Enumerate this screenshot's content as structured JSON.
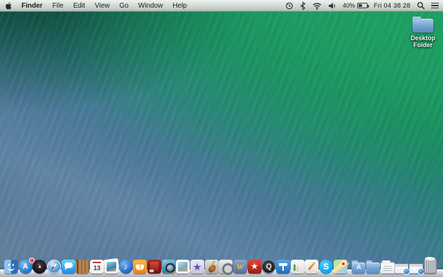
{
  "menu_bar": {
    "app_name": "Finder",
    "menus": [
      "File",
      "Edit",
      "View",
      "Go",
      "Window",
      "Help"
    ],
    "status": {
      "icons": [
        "time-machine",
        "bluetooth",
        "wifi",
        "volume"
      ],
      "battery_percent": "40%",
      "clock": "Fri 04 38 28"
    }
  },
  "desktop": {
    "folder_label": "Desktop Folder"
  },
  "dock": {
    "items": [
      {
        "id": "finder",
        "label": "Finder"
      },
      {
        "id": "app-store",
        "label": "App Store",
        "glyph": "A",
        "badge": ""
      },
      {
        "id": "dashboard",
        "label": "Dashboard"
      },
      {
        "id": "safari",
        "label": "Safari"
      },
      {
        "id": "messages",
        "label": "Messages"
      },
      {
        "id": "contacts",
        "label": "Contacts"
      },
      {
        "id": "calendar",
        "label": "Calendar",
        "glyph": "13"
      },
      {
        "id": "photos",
        "label": "Photos"
      },
      {
        "id": "itunes",
        "label": "iTunes",
        "glyph": "♪"
      },
      {
        "id": "ibooks",
        "label": "iBooks"
      },
      {
        "id": "photo-booth",
        "label": "Photo Booth"
      },
      {
        "id": "iphoto",
        "label": "iPhoto"
      },
      {
        "id": "preview",
        "label": "Preview"
      },
      {
        "id": "imovie",
        "label": "iMovie",
        "glyph": "★"
      },
      {
        "id": "garageband",
        "label": "GarageBand"
      },
      {
        "id": "system-preferences",
        "label": "System Preferences"
      },
      {
        "id": "word",
        "label": "Microsoft Word",
        "glyph": "W"
      },
      {
        "id": "wunderlist",
        "label": "Wunderlist",
        "glyph": "★"
      },
      {
        "id": "quicktime",
        "label": "QuickTime Player",
        "glyph": "Q"
      },
      {
        "id": "keynote",
        "label": "Keynote"
      },
      {
        "id": "numbers",
        "label": "Numbers"
      },
      {
        "id": "pages",
        "label": "Pages"
      },
      {
        "id": "skype",
        "label": "Skype",
        "glyph": "S"
      },
      {
        "id": "maps",
        "label": "Maps"
      },
      {
        "id": "separator",
        "label": "",
        "separator": true
      },
      {
        "id": "folder-applications",
        "label": "Applications Folder",
        "glyph": "A"
      },
      {
        "id": "folder-documents",
        "label": "Documents Folder"
      },
      {
        "id": "downloads",
        "label": "Downloads Stack"
      },
      {
        "id": "min-window-1",
        "label": "Minimized Window"
      },
      {
        "id": "min-window-2",
        "label": "Minimized Window"
      },
      {
        "id": "trash",
        "label": "Trash"
      }
    ]
  },
  "colors": {
    "wallpaper_green": "#1c9464",
    "wallpaper_teal": "#0b5a43",
    "wallpaper_blue": "#4a6f94",
    "menubar_light": "#eef2ee",
    "badge_red": "#d41c0f"
  }
}
